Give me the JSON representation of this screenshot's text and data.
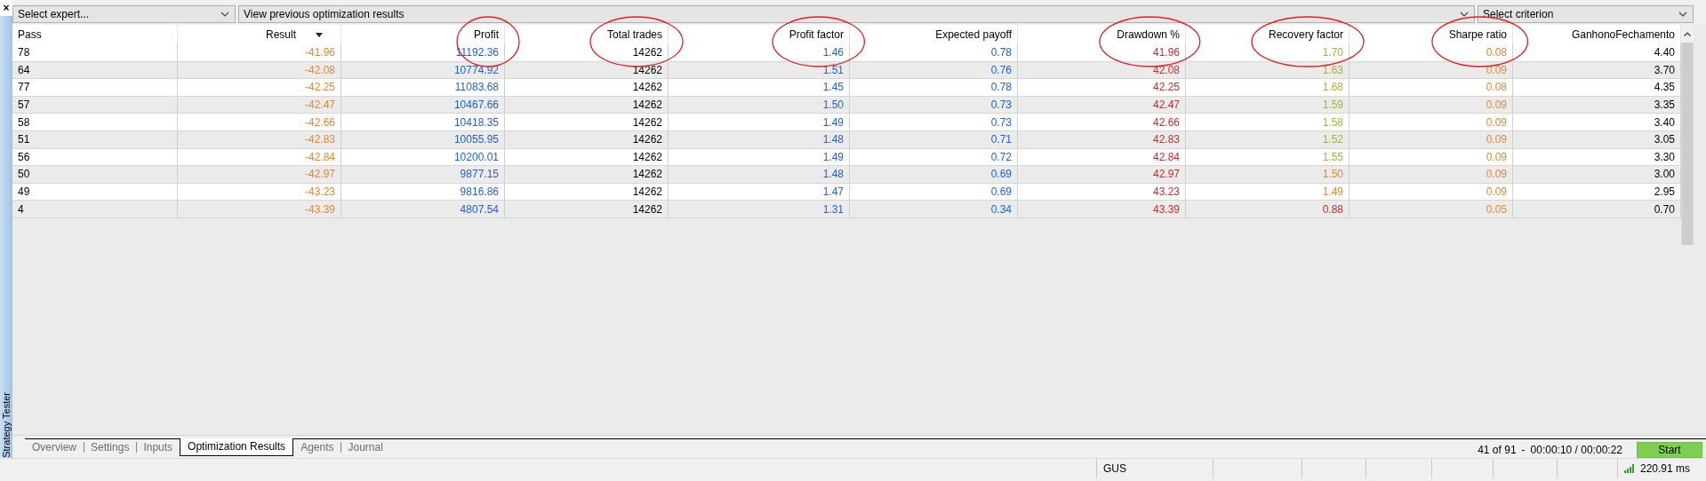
{
  "sidebar": {
    "close": "×",
    "title": "Strategy Tester"
  },
  "toolbar": {
    "expert_select": "Select expert...",
    "results_select": "View previous optimization results",
    "criterion_select": "Select criterion"
  },
  "table": {
    "columns": [
      {
        "label": "Pass",
        "circled": false,
        "sorted": false
      },
      {
        "label": "Result",
        "circled": false,
        "sorted": true
      },
      {
        "label": "Profit",
        "circled": true,
        "sorted": false
      },
      {
        "label": "Total trades",
        "circled": true,
        "sorted": false
      },
      {
        "label": "Profit factor",
        "circled": true,
        "sorted": false
      },
      {
        "label": "Expected payoff",
        "circled": false,
        "sorted": false
      },
      {
        "label": "Drawdown %",
        "circled": true,
        "sorted": false
      },
      {
        "label": "Recovery factor",
        "circled": true,
        "sorted": false
      },
      {
        "label": "Sharpe ratio",
        "circled": true,
        "sorted": false
      },
      {
        "label": "GanhonoFechamento",
        "circled": false,
        "sorted": false
      }
    ],
    "rows": [
      {
        "cells": [
          {
            "text": "78",
            "color": "#000000"
          },
          {
            "text": "-41.96",
            "color": "#e8861e"
          },
          {
            "text": "11192.36",
            "color": "#1f5fd6"
          },
          {
            "text": "14262",
            "color": "#000000"
          },
          {
            "text": "1.46",
            "color": "#1f5fd6"
          },
          {
            "text": "0.78",
            "color": "#1f5fd6"
          },
          {
            "text": "41.96",
            "color": "#d32626"
          },
          {
            "text": "1.70",
            "color": "#a5b51d"
          },
          {
            "text": "0.08",
            "color": "#e8861e"
          },
          {
            "text": "4.40",
            "color": "#000000"
          }
        ]
      },
      {
        "cells": [
          {
            "text": "64",
            "color": "#000000"
          },
          {
            "text": "-42.08",
            "color": "#e8861e"
          },
          {
            "text": "10774.92",
            "color": "#1f5fd6"
          },
          {
            "text": "14262",
            "color": "#000000"
          },
          {
            "text": "1.51",
            "color": "#1f5fd6"
          },
          {
            "text": "0.76",
            "color": "#1f5fd6"
          },
          {
            "text": "42.08",
            "color": "#d32626"
          },
          {
            "text": "1.63",
            "color": "#a5b51d"
          },
          {
            "text": "0.09",
            "color": "#e8861e"
          },
          {
            "text": "3.70",
            "color": "#000000"
          }
        ]
      },
      {
        "cells": [
          {
            "text": "77",
            "color": "#000000"
          },
          {
            "text": "-42.25",
            "color": "#e8861e"
          },
          {
            "text": "11083.68",
            "color": "#1f5fd6"
          },
          {
            "text": "14262",
            "color": "#000000"
          },
          {
            "text": "1.45",
            "color": "#1f5fd6"
          },
          {
            "text": "0.78",
            "color": "#1f5fd6"
          },
          {
            "text": "42.25",
            "color": "#d32626"
          },
          {
            "text": "1.68",
            "color": "#a5b51d"
          },
          {
            "text": "0.08",
            "color": "#e8861e"
          },
          {
            "text": "4.35",
            "color": "#000000"
          }
        ]
      },
      {
        "cells": [
          {
            "text": "57",
            "color": "#000000"
          },
          {
            "text": "-42.47",
            "color": "#e8861e"
          },
          {
            "text": "10467.66",
            "color": "#1f5fd6"
          },
          {
            "text": "14262",
            "color": "#000000"
          },
          {
            "text": "1.50",
            "color": "#1f5fd6"
          },
          {
            "text": "0.73",
            "color": "#1f5fd6"
          },
          {
            "text": "42.47",
            "color": "#d32626"
          },
          {
            "text": "1.59",
            "color": "#a5b51d"
          },
          {
            "text": "0.09",
            "color": "#e8861e"
          },
          {
            "text": "3.35",
            "color": "#000000"
          }
        ]
      },
      {
        "cells": [
          {
            "text": "58",
            "color": "#000000"
          },
          {
            "text": "-42.66",
            "color": "#e8861e"
          },
          {
            "text": "10418.35",
            "color": "#1f5fd6"
          },
          {
            "text": "14262",
            "color": "#000000"
          },
          {
            "text": "1.49",
            "color": "#1f5fd6"
          },
          {
            "text": "0.73",
            "color": "#1f5fd6"
          },
          {
            "text": "42.66",
            "color": "#d32626"
          },
          {
            "text": "1.58",
            "color": "#a5b51d"
          },
          {
            "text": "0.09",
            "color": "#e8861e"
          },
          {
            "text": "3.40",
            "color": "#000000"
          }
        ]
      },
      {
        "cells": [
          {
            "text": "51",
            "color": "#000000"
          },
          {
            "text": "-42.83",
            "color": "#e8861e"
          },
          {
            "text": "10055.95",
            "color": "#1f5fd6"
          },
          {
            "text": "14262",
            "color": "#000000"
          },
          {
            "text": "1.48",
            "color": "#1f5fd6"
          },
          {
            "text": "0.71",
            "color": "#1f5fd6"
          },
          {
            "text": "42.83",
            "color": "#d32626"
          },
          {
            "text": "1.52",
            "color": "#a5b51d"
          },
          {
            "text": "0.09",
            "color": "#e8861e"
          },
          {
            "text": "3.05",
            "color": "#000000"
          }
        ]
      },
      {
        "cells": [
          {
            "text": "56",
            "color": "#000000"
          },
          {
            "text": "-42.84",
            "color": "#e8861e"
          },
          {
            "text": "10200.01",
            "color": "#1f5fd6"
          },
          {
            "text": "14262",
            "color": "#000000"
          },
          {
            "text": "1.49",
            "color": "#1f5fd6"
          },
          {
            "text": "0.72",
            "color": "#1f5fd6"
          },
          {
            "text": "42.84",
            "color": "#d32626"
          },
          {
            "text": "1.55",
            "color": "#a5b51d"
          },
          {
            "text": "0.09",
            "color": "#e8861e"
          },
          {
            "text": "3.30",
            "color": "#000000"
          }
        ]
      },
      {
        "cells": [
          {
            "text": "50",
            "color": "#000000"
          },
          {
            "text": "-42.97",
            "color": "#e8861e"
          },
          {
            "text": "9877.15",
            "color": "#1f5fd6"
          },
          {
            "text": "14262",
            "color": "#000000"
          },
          {
            "text": "1.48",
            "color": "#1f5fd6"
          },
          {
            "text": "0.69",
            "color": "#1f5fd6"
          },
          {
            "text": "42.97",
            "color": "#d32626"
          },
          {
            "text": "1.50",
            "color": "#e8861e"
          },
          {
            "text": "0.09",
            "color": "#e8861e"
          },
          {
            "text": "3.00",
            "color": "#000000"
          }
        ]
      },
      {
        "cells": [
          {
            "text": "49",
            "color": "#000000"
          },
          {
            "text": "-43.23",
            "color": "#e8861e"
          },
          {
            "text": "9816.86",
            "color": "#1f5fd6"
          },
          {
            "text": "14262",
            "color": "#000000"
          },
          {
            "text": "1.47",
            "color": "#1f5fd6"
          },
          {
            "text": "0.69",
            "color": "#1f5fd6"
          },
          {
            "text": "43.23",
            "color": "#d32626"
          },
          {
            "text": "1.49",
            "color": "#e8861e"
          },
          {
            "text": "0.09",
            "color": "#e8861e"
          },
          {
            "text": "2.95",
            "color": "#000000"
          }
        ]
      },
      {
        "cells": [
          {
            "text": "4",
            "color": "#000000"
          },
          {
            "text": "-43.39",
            "color": "#e8861e"
          },
          {
            "text": "4807.54",
            "color": "#1f5fd6"
          },
          {
            "text": "14262",
            "color": "#000000"
          },
          {
            "text": "1.31",
            "color": "#1f5fd6"
          },
          {
            "text": "0.34",
            "color": "#1f5fd6"
          },
          {
            "text": "43.39",
            "color": "#d32626"
          },
          {
            "text": "0.88",
            "color": "#d32626"
          },
          {
            "text": "0.05",
            "color": "#e8861e"
          },
          {
            "text": "0.70",
            "color": "#000000"
          }
        ]
      }
    ]
  },
  "tabs": [
    {
      "label": "Overview",
      "selected": false
    },
    {
      "label": "Settings",
      "selected": false
    },
    {
      "label": "Inputs",
      "selected": false
    },
    {
      "label": "Optimization Results",
      "selected": true
    },
    {
      "label": "Agents",
      "selected": false
    },
    {
      "label": "Journal",
      "selected": false
    }
  ],
  "progress": {
    "count": "41 of 91",
    "separator": "-",
    "time": "00:00:10 / 00:00:22"
  },
  "start_button": "Start",
  "status_bar": {
    "account": "GUS",
    "ping": "220.91 ms"
  }
}
